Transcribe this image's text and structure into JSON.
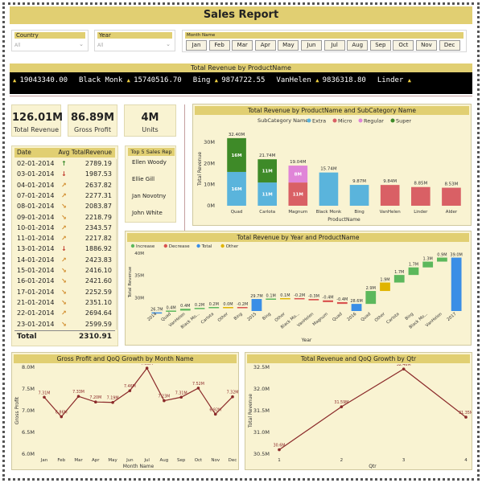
{
  "title": "Sales Report",
  "filters": {
    "country": {
      "label": "Country",
      "value": "All"
    },
    "year": {
      "label": "Year",
      "value": "All"
    },
    "month": {
      "label": "Month Name",
      "options": [
        "Jan",
        "Feb",
        "Mar",
        "Apr",
        "May",
        "Jun",
        "Jul",
        "Aug",
        "Sep",
        "Oct",
        "Nov",
        "Dec"
      ]
    }
  },
  "ticker": {
    "title": "Total Revenue by ProductName",
    "items": [
      {
        "name": "",
        "value": "19043340.00"
      },
      {
        "name": "Black Monk",
        "value": "15740516.70"
      },
      {
        "name": "Bing",
        "value": "9874722.55"
      },
      {
        "name": "VanHelen",
        "value": "9836318.80"
      },
      {
        "name": "Linder",
        "value": ""
      }
    ]
  },
  "kpis": [
    {
      "value": "126.01M",
      "label": "Total Revenue"
    },
    {
      "value": "86.89M",
      "label": "Gross Profit"
    },
    {
      "value": "4M",
      "label": "Units"
    }
  ],
  "daily_table": {
    "headers": [
      "Date",
      "Avg TotalRevenue"
    ],
    "rows": [
      {
        "date": "02-01-2014",
        "value": "2789.19",
        "trend": "up"
      },
      {
        "date": "03-01-2014",
        "value": "1987.53",
        "trend": "down"
      },
      {
        "date": "04-01-2014",
        "value": "2637.82",
        "trend": "up-right"
      },
      {
        "date": "07-01-2014",
        "value": "2277.31",
        "trend": "up-right"
      },
      {
        "date": "08-01-2014",
        "value": "2083.87",
        "trend": "down-right"
      },
      {
        "date": "09-01-2014",
        "value": "2218.79",
        "trend": "down-right"
      },
      {
        "date": "10-01-2014",
        "value": "2343.57",
        "trend": "up-right"
      },
      {
        "date": "11-01-2014",
        "value": "2217.82",
        "trend": "up-right"
      },
      {
        "date": "13-01-2014",
        "value": "1886.92",
        "trend": "down"
      },
      {
        "date": "14-01-2014",
        "value": "2423.83",
        "trend": "up-right"
      },
      {
        "date": "15-01-2014",
        "value": "2416.10",
        "trend": "down-right"
      },
      {
        "date": "16-01-2014",
        "value": "2421.60",
        "trend": "down-right"
      },
      {
        "date": "17-01-2014",
        "value": "2252.59",
        "trend": "down-right"
      },
      {
        "date": "21-01-2014",
        "value": "2351.10",
        "trend": "down-right"
      },
      {
        "date": "22-01-2014",
        "value": "2694.64",
        "trend": "up-right"
      },
      {
        "date": "23-01-2014",
        "value": "2599.59",
        "trend": "down-right"
      }
    ],
    "total_label": "Total",
    "total_value": "2310.91"
  },
  "top_reps": {
    "title": "Top 5 Sales Rep",
    "names": [
      "Ellen Woody",
      "Ellie Gill",
      "Jan Novotny",
      "John White"
    ]
  },
  "colors": {
    "accent": "#e1cf72",
    "panel": "#f9f3d2",
    "up": "#3a8a2a",
    "down": "#c0392b",
    "neutral": "#d08a2a"
  },
  "chart_data": [
    {
      "type": "bar",
      "title": "Total Revenue by ProductName and SubCategory Name",
      "legend_title": "SubCategory Name",
      "legend": [
        {
          "name": "Extra",
          "color": "#5ab4dc"
        },
        {
          "name": "Micro",
          "color": "#d96065"
        },
        {
          "name": "Regular",
          "color": "#e085d8"
        },
        {
          "name": "Super",
          "color": "#3e8a28"
        }
      ],
      "categories": [
        "Quad",
        "Carlota",
        "Magnum",
        "Black Monk",
        "Bing",
        "VanHelen",
        "Linder",
        "Alder"
      ],
      "series": [
        {
          "name": "Extra",
          "values": [
            16,
            11,
            0,
            15.74,
            9.87,
            0,
            0,
            0
          ]
        },
        {
          "name": "Micro",
          "values": [
            0,
            0,
            11,
            0,
            0,
            9.84,
            8.85,
            8.53
          ]
        },
        {
          "name": "Regular",
          "values": [
            0,
            0,
            8,
            0,
            0,
            0,
            0,
            0
          ]
        },
        {
          "name": "Super",
          "values": [
            16,
            11,
            0,
            0,
            0,
            0,
            0,
            0
          ]
        }
      ],
      "segment_labels": [
        [
          "16M",
          "16M"
        ],
        [
          "11M",
          "11M"
        ],
        [
          "11M",
          "8M"
        ],
        [
          "",
          ""
        ],
        [
          "",
          ""
        ],
        [
          "",
          ""
        ],
        [
          "",
          ""
        ],
        [
          "",
          ""
        ]
      ],
      "totals": [
        "32.40M",
        "21.74M",
        "19.04M",
        "15.74M",
        "9.87M",
        "9.84M",
        "8.85M",
        "8.53M"
      ],
      "ylabel": "Total Revenue",
      "xlabel": "ProductName",
      "yticks": [
        "0M",
        "10M",
        "20M",
        "30M"
      ],
      "ylim": [
        0,
        35
      ]
    },
    {
      "type": "waterfall",
      "title": "Total Revenue by Year and ProductName",
      "legend": [
        {
          "name": "Increase",
          "color": "#5cb85c"
        },
        {
          "name": "Decrease",
          "color": "#d9534f"
        },
        {
          "name": "Total",
          "color": "#3a8ee6"
        },
        {
          "name": "Other",
          "color": "#e0b400"
        }
      ],
      "steps": [
        {
          "label": "2014",
          "delta": 26.7,
          "kind": "total",
          "text": "26.7M"
        },
        {
          "label": "Quad",
          "delta": 0.4,
          "kind": "increase",
          "text": "0.4M"
        },
        {
          "label": "VanHelen",
          "delta": 0.4,
          "kind": "increase",
          "text": "0.4M"
        },
        {
          "label": "Black Mo...",
          "delta": 0.2,
          "kind": "increase",
          "text": "0.2M"
        },
        {
          "label": "Carlota",
          "delta": 0.2,
          "kind": "increase",
          "text": "0.2M"
        },
        {
          "label": "Other",
          "delta": 0.0,
          "kind": "other",
          "text": "0.0M"
        },
        {
          "label": "Bing",
          "delta": -0.2,
          "kind": "decrease",
          "text": "-0.2M"
        },
        {
          "label": "2015",
          "delta": 29.7,
          "kind": "total",
          "text": "29.7M"
        },
        {
          "label": "Bing",
          "delta": 0.1,
          "kind": "increase",
          "text": "0.1M"
        },
        {
          "label": "Other",
          "delta": 0.1,
          "kind": "other",
          "text": "0.1M"
        },
        {
          "label": "Black Mo...",
          "delta": -0.2,
          "kind": "decrease",
          "text": "-0.2M"
        },
        {
          "label": "VanHelen",
          "delta": -0.3,
          "kind": "decrease",
          "text": "-0.3M"
        },
        {
          "label": "Magnum",
          "delta": -0.4,
          "kind": "decrease",
          "text": "-0.4M"
        },
        {
          "label": "Quad",
          "delta": -0.4,
          "kind": "decrease",
          "text": "-0.4M"
        },
        {
          "label": "2016",
          "delta": 28.6,
          "kind": "total",
          "text": "28.6M"
        },
        {
          "label": "Quad",
          "delta": 2.9,
          "kind": "increase",
          "text": "2.9M"
        },
        {
          "label": "Other",
          "delta": 1.9,
          "kind": "other",
          "text": "1.9M"
        },
        {
          "label": "Carlota",
          "delta": 1.7,
          "kind": "increase",
          "text": "1.7M"
        },
        {
          "label": "Bing",
          "delta": 1.7,
          "kind": "increase",
          "text": "1.7M"
        },
        {
          "label": "Black Mo...",
          "delta": 1.3,
          "kind": "increase",
          "text": "1.3M"
        },
        {
          "label": "VanHelen",
          "delta": 0.9,
          "kind": "increase",
          "text": "0.9M"
        },
        {
          "label": "2017",
          "delta": 39.0,
          "kind": "total",
          "text": "39.0M"
        }
      ],
      "ylabel": "Total Revenue",
      "xlabel": "Year",
      "yticks": [
        "30M",
        "35M",
        "40M"
      ],
      "ylim": [
        27,
        40
      ]
    },
    {
      "type": "line",
      "title": "Gross Profit and QoQ Growth by Month Name",
      "categories": [
        "Jan",
        "Feb",
        "Mar",
        "Apr",
        "May",
        "Jun",
        "Jul",
        "Aug",
        "Sep",
        "Oct",
        "Nov",
        "Dec"
      ],
      "values": [
        7.31,
        6.86,
        7.33,
        7.2,
        7.19,
        7.46,
        7.98,
        7.23,
        7.31,
        7.52,
        6.92,
        7.32
      ],
      "labels": [
        "7.31M",
        "6.86M",
        "7.33M",
        "7.20M",
        "7.19M",
        "7.46M",
        "7.98M",
        "7.23M",
        "7.31M",
        "7.52M",
        "6.92M",
        "7.32M"
      ],
      "ylabel": "Gross Profit",
      "xlabel": "Month Name",
      "yticks": [
        "6.0M",
        "6.5M",
        "7.0M",
        "7.5M",
        "8.0M"
      ],
      "ylim": [
        6.0,
        8.0
      ]
    },
    {
      "type": "line",
      "title": "Total Revenue and QoQ Growth by Qtr",
      "categories": [
        "1",
        "2",
        "3",
        "4"
      ],
      "values": [
        30.6,
        31.59,
        32.46,
        31.35
      ],
      "labels": [
        "30.6M",
        "31.59M",
        "32.46M",
        "31.35M"
      ],
      "ylabel": "Total Revenue",
      "xlabel": "Qtr",
      "yticks": [
        "30.5M",
        "31.0M",
        "31.5M",
        "32.0M",
        "32.5M"
      ],
      "ylim": [
        30.5,
        32.5
      ]
    }
  ]
}
